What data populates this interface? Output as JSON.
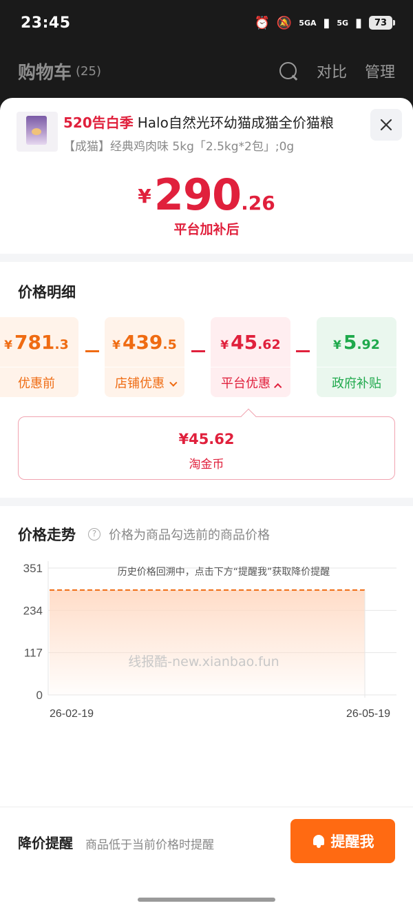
{
  "status_bar": {
    "time": "23:45",
    "net1": "5GA",
    "net2": "5G",
    "battery": "73"
  },
  "header": {
    "title": "购物车",
    "count": "(25)",
    "compare_label": "对比",
    "manage_label": "管理"
  },
  "product": {
    "promo_tag": "520告白季",
    "name": "Halo自然光环幼猫成猫全价猫粮",
    "sku": "【成猫】经典鸡肉味 5kg「2.5kg*2包」;0g"
  },
  "final_price": {
    "currency": "¥",
    "integer": "290",
    "decimal": ".26",
    "caption": "平台加补后"
  },
  "breakdown": {
    "title": "价格明细",
    "items": [
      {
        "currency": "¥",
        "integer": "781",
        "decimal": ".3",
        "label": "优惠前"
      },
      {
        "currency": "¥",
        "integer": "439",
        "decimal": ".5",
        "label": "店铺优惠"
      },
      {
        "currency": "¥",
        "integer": "45",
        "decimal": ".62",
        "label": "平台优惠"
      },
      {
        "currency": "¥",
        "integer": "5",
        "decimal": ".92",
        "label": "政府补贴"
      }
    ],
    "detail": {
      "amount": "¥45.62",
      "name": "淘金币"
    }
  },
  "trend": {
    "title": "价格走势",
    "note": "价格为商品勾选前的商品价格",
    "overlay_text": "历史价格回溯中，点击下方“提醒我”获取降价提醒",
    "watermark": "线报酷-new.xianbao.fun"
  },
  "chart_data": {
    "type": "area",
    "x": [
      "26-02-19",
      "26-05-19"
    ],
    "xlabel": "",
    "ylabel": "",
    "y_ticks": [
      0,
      117,
      234,
      351
    ],
    "ylim": [
      0,
      351
    ],
    "series": [
      {
        "values": [
          290.26,
          290.26
        ]
      }
    ],
    "colors": {
      "line": "#ef6b12",
      "fill": "#ffd9c2"
    }
  },
  "price_alert": {
    "title": "降价提醒",
    "subtitle": "商品低于当前价格时提醒",
    "button_label": "提醒我"
  },
  "colors": {
    "brand_red": "#e0203c",
    "orange": "#ef6b12",
    "green": "#1fa94c",
    "button": "#ff6a12"
  }
}
